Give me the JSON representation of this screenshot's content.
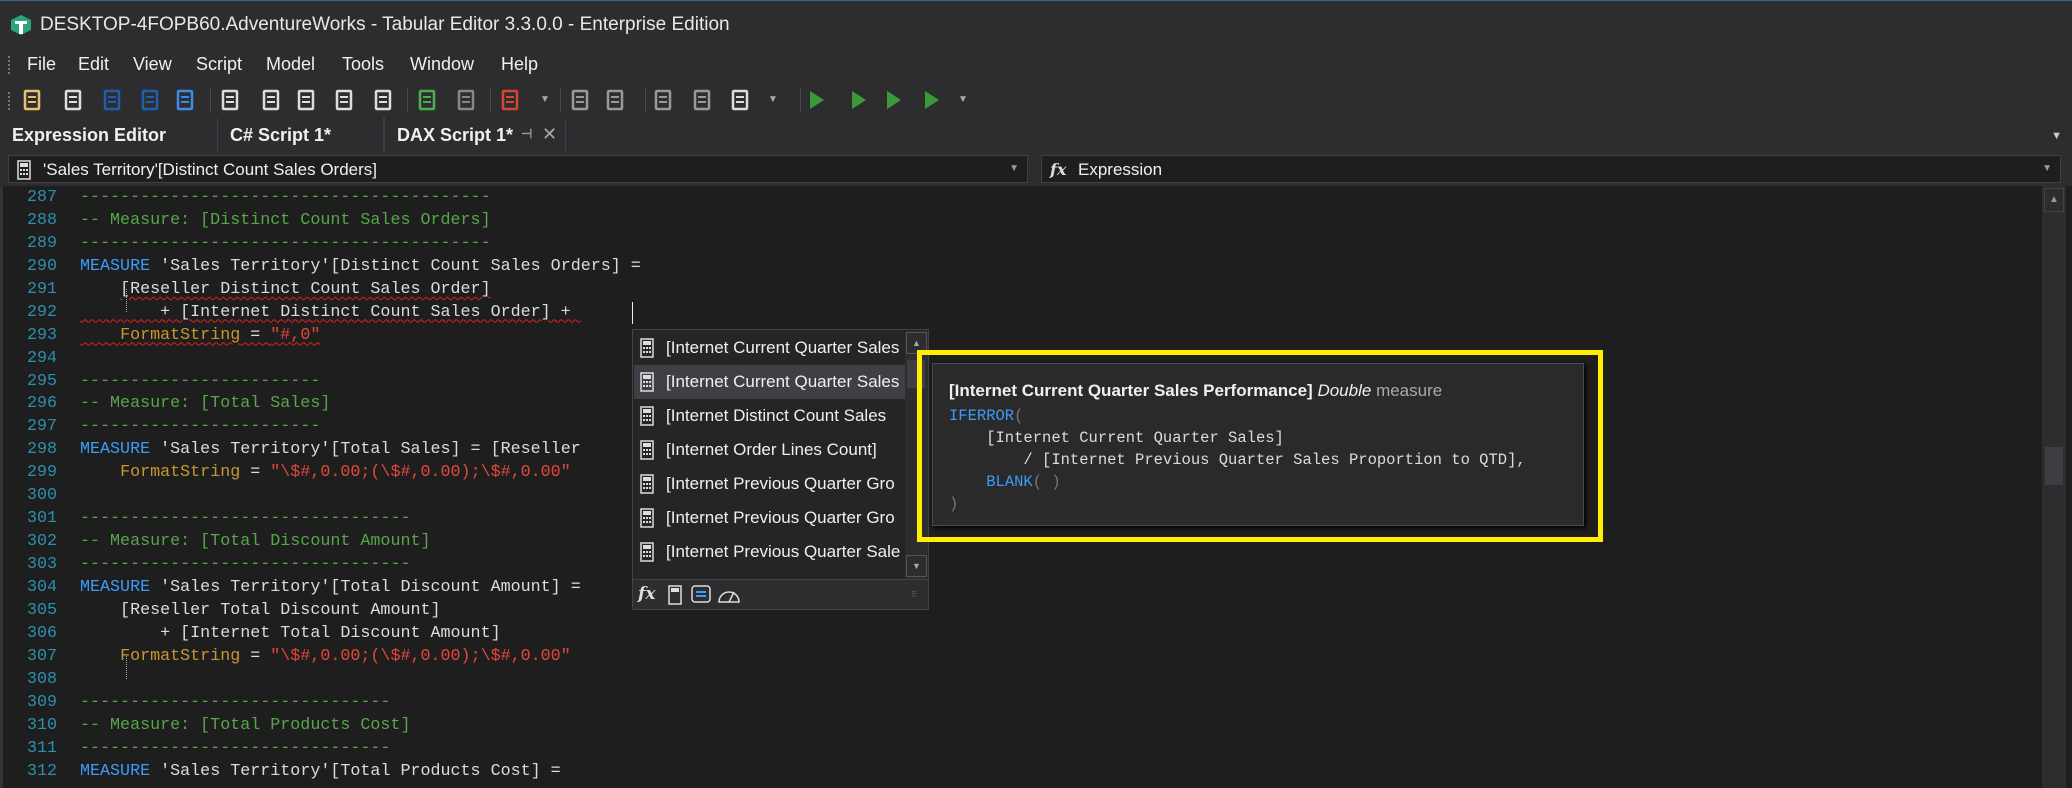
{
  "window": {
    "title": "DESKTOP-4FOPB60.AdventureWorks - Tabular Editor 3.3.0.0 - Enterprise Edition",
    "app_icon": "tabular-editor-icon"
  },
  "menu": [
    "File",
    "Edit",
    "View",
    "Script",
    "Model",
    "Tools",
    "Window",
    "Help"
  ],
  "toolbar": [
    "open-icon",
    "deploy-icon",
    "save-icon",
    "save-all-icon",
    "refresh-icon",
    "new-document-icon",
    "new-diagram-icon",
    "new-pivot-icon",
    "new-hierarchy-icon",
    "new-script-icon",
    "format-dax-icon",
    "format-dax-alt-icon",
    "bpa-icon",
    "column-icon",
    "move-icon",
    "panel-icon",
    "comment-icon",
    "layout-icon",
    "run-icon",
    "run-selection-icon",
    "run-script-icon",
    "save-run-icon"
  ],
  "tabs": [
    {
      "label": "Expression Editor",
      "active": false
    },
    {
      "label": "C# Script 1*",
      "active": false
    },
    {
      "label": "DAX Script 1*",
      "active": true
    }
  ],
  "object_selector": {
    "value": "'Sales Territory'[Distinct Count Sales Orders]",
    "icon": "calculator-icon"
  },
  "property_selector": {
    "value": "Expression",
    "icon": "fx-icon"
  },
  "code": [
    {
      "n": "287",
      "t": [
        [
          "-----------------------------------------",
          "cmt"
        ]
      ]
    },
    {
      "n": "288",
      "t": [
        [
          "-- Measure: [Distinct Count Sales Orders]",
          "cmt"
        ]
      ]
    },
    {
      "n": "289",
      "t": [
        [
          "-----------------------------------------",
          "cmt"
        ]
      ]
    },
    {
      "n": "290",
      "t": [
        [
          "MEASURE",
          "kw"
        ],
        [
          " 'Sales Territory'[Distinct Count Sales Orders] =",
          "txt"
        ]
      ]
    },
    {
      "n": "291",
      "t": [
        [
          "    ",
          "txt"
        ],
        [
          "[Reseller Distinct Count Sales Order]",
          "txt sq"
        ]
      ]
    },
    {
      "n": "292",
      "t": [
        [
          "        + [Internet Distinct Count Sales Order] + ",
          "txt sq"
        ]
      ]
    },
    {
      "n": "293",
      "t": [
        [
          "    ",
          "txt sq"
        ],
        [
          "FormatString",
          "prop sq"
        ],
        [
          " = ",
          "txt sq"
        ],
        [
          "\"#,0\"",
          "str sq"
        ]
      ]
    },
    {
      "n": "294",
      "t": []
    },
    {
      "n": "295",
      "t": [
        [
          "------------------------",
          "cmt"
        ]
      ]
    },
    {
      "n": "296",
      "t": [
        [
          "-- Measure: [Total Sales]",
          "cmt"
        ]
      ]
    },
    {
      "n": "297",
      "t": [
        [
          "------------------------",
          "cmt"
        ]
      ]
    },
    {
      "n": "298",
      "t": [
        [
          "MEASURE",
          "kw"
        ],
        [
          " 'Sales Territory'[Total Sales] = [Reseller",
          "txt"
        ]
      ]
    },
    {
      "n": "299",
      "t": [
        [
          "    ",
          "txt"
        ],
        [
          "FormatString",
          "prop"
        ],
        [
          " = ",
          "txt"
        ],
        [
          "\"\\$#,0.00;(\\$#,0.00);\\$#,0.00\"",
          "str"
        ]
      ]
    },
    {
      "n": "300",
      "t": []
    },
    {
      "n": "301",
      "t": [
        [
          "---------------------------------",
          "cmt"
        ]
      ]
    },
    {
      "n": "302",
      "t": [
        [
          "-- Measure: [Total Discount Amount]",
          "cmt"
        ]
      ]
    },
    {
      "n": "303",
      "t": [
        [
          "---------------------------------",
          "cmt"
        ]
      ]
    },
    {
      "n": "304",
      "t": [
        [
          "MEASURE",
          "kw"
        ],
        [
          " 'Sales Territory'[Total Discount Amount] =",
          "txt"
        ]
      ]
    },
    {
      "n": "305",
      "t": [
        [
          "    [Reseller Total Discount Amount]",
          "txt"
        ]
      ]
    },
    {
      "n": "306",
      "t": [
        [
          "        + [Internet Total Discount Amount]",
          "txt"
        ]
      ]
    },
    {
      "n": "307",
      "t": [
        [
          "    ",
          "txt"
        ],
        [
          "FormatString",
          "prop"
        ],
        [
          " = ",
          "txt"
        ],
        [
          "\"\\$#,0.00;(\\$#,0.00);\\$#,0.00\"",
          "str"
        ]
      ]
    },
    {
      "n": "308",
      "t": []
    },
    {
      "n": "309",
      "t": [
        [
          "-------------------------------",
          "cmt"
        ]
      ]
    },
    {
      "n": "310",
      "t": [
        [
          "-- Measure: [Total Products Cost]",
          "cmt"
        ]
      ]
    },
    {
      "n": "311",
      "t": [
        [
          "-------------------------------",
          "cmt"
        ]
      ]
    },
    {
      "n": "312",
      "t": [
        [
          "MEASURE",
          "kw"
        ],
        [
          " 'Sales Territory'[Total Products Cost] =",
          "txt"
        ]
      ]
    }
  ],
  "autocomplete": {
    "items": [
      "[Internet Current Quarter Sales",
      "[Internet Current Quarter Sales",
      "[Internet Distinct Count Sales",
      "[Internet Order Lines Count]",
      "[Internet Previous Quarter Gro",
      "[Internet Previous Quarter Gro",
      "[Internet Previous Quarter Sale"
    ],
    "selected_index": 1,
    "filters": [
      "fx-icon",
      "measure-icon",
      "column-icon",
      "kpi-icon"
    ]
  },
  "tooltip": {
    "name": "[Internet Current Quarter Sales Performance]",
    "type": "Double",
    "kind": "measure",
    "lines": [
      [
        [
          "IFERROR",
          "kw"
        ],
        [
          "(",
          "gray"
        ]
      ],
      [
        [
          "    [Internet Current Quarter Sales]",
          "txt"
        ]
      ],
      [
        [
          "        / [Internet Previous Quarter Sales Proportion to QTD],",
          "txt"
        ]
      ],
      [
        [
          "    ",
          "txt"
        ],
        [
          "BLANK",
          "kw"
        ],
        [
          "( )",
          "gray"
        ]
      ],
      [
        [
          ")",
          "gray"
        ]
      ]
    ],
    "highlight_color": "#ffee00"
  }
}
